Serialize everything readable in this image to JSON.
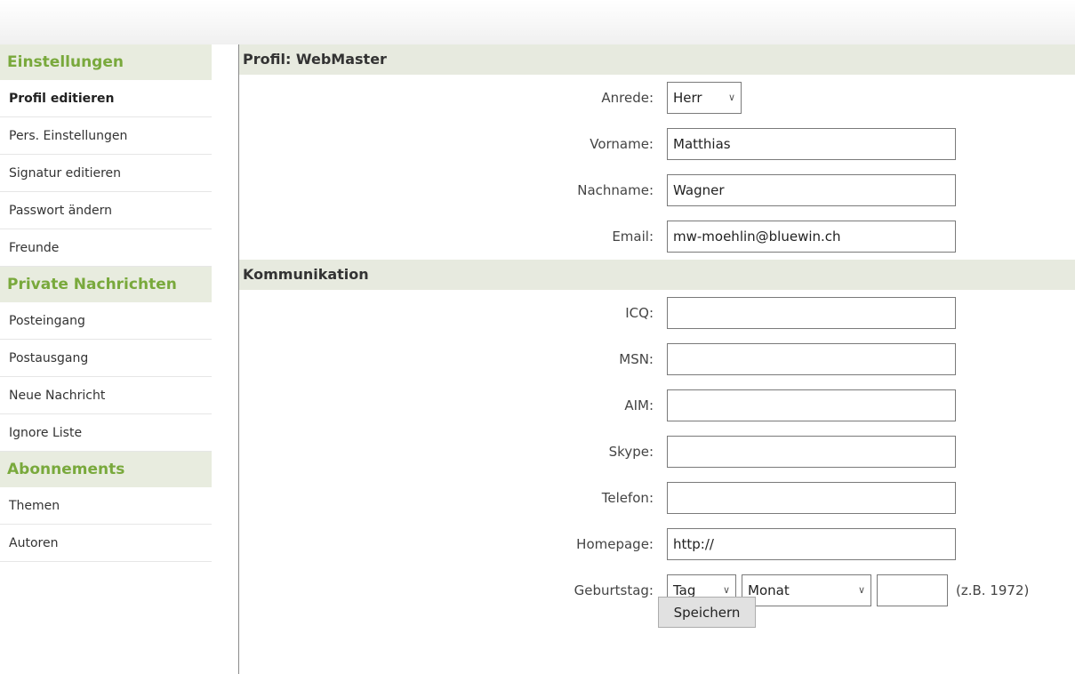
{
  "sidebar": {
    "sections": [
      {
        "title": "Einstellungen",
        "items": [
          "Profil editieren",
          "Pers. Einstellungen",
          "Signatur editieren",
          "Passwort ändern",
          "Freunde"
        ]
      },
      {
        "title": "Private Nachrichten",
        "items": [
          "Posteingang",
          "Postausgang",
          "Neue Nachricht",
          "Ignore Liste"
        ]
      },
      {
        "title": "Abonnements",
        "items": [
          "Themen",
          "Autoren"
        ]
      }
    ],
    "active_item": "Profil editieren"
  },
  "profile": {
    "heading": "Profil: WebMaster",
    "anrede_label": "Anrede:",
    "anrede_value": "Herr",
    "vorname_label": "Vorname:",
    "vorname_value": "Matthias",
    "nachname_label": "Nachname:",
    "nachname_value": "Wagner",
    "email_label": "Email:",
    "email_value": "mw-moehlin@bluewin.ch"
  },
  "communication": {
    "heading": "Kommunikation",
    "icq_label": "ICQ:",
    "icq_value": "",
    "msn_label": "MSN:",
    "msn_value": "",
    "aim_label": "AIM:",
    "aim_value": "",
    "skype_label": "Skype:",
    "skype_value": "",
    "telefon_label": "Telefon:",
    "telefon_value": "",
    "homepage_label": "Homepage:",
    "homepage_value": "http://",
    "birthday_label": "Geburtstag:",
    "birthday_day": "Tag",
    "birthday_month": "Monat",
    "birthday_year": "",
    "birthday_hint": "(z.B. 1972)"
  },
  "actions": {
    "save_label": "Speichern"
  },
  "colors": {
    "sidebar_heading": "#79a93c",
    "section_bg": "#e7eadf"
  }
}
